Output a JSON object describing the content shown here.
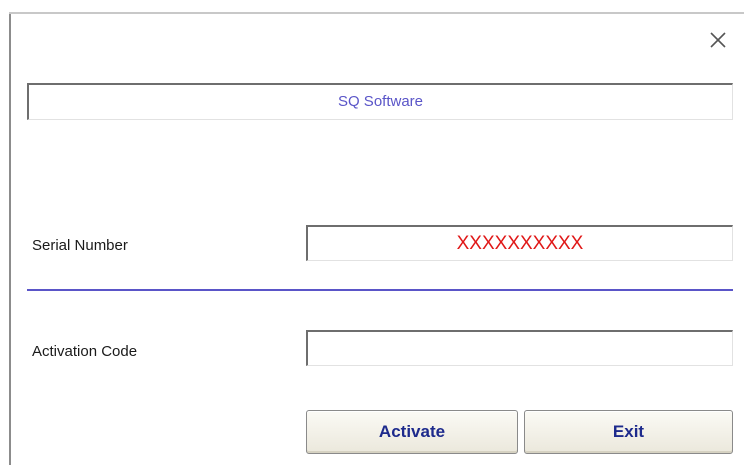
{
  "dialog": {
    "title": "SQ Software",
    "serial_label": "Serial Number",
    "serial_value": "XXXXXXXXXX",
    "activation_label": "Activation Code",
    "activation_value": "",
    "activate_label": "Activate",
    "exit_label": "Exit",
    "close_icon": "close-icon"
  },
  "colors": {
    "title_text": "#5a55c8",
    "serial_text": "#e01818",
    "separator": "#5a55c8",
    "button_text": "#1d2a8c"
  }
}
